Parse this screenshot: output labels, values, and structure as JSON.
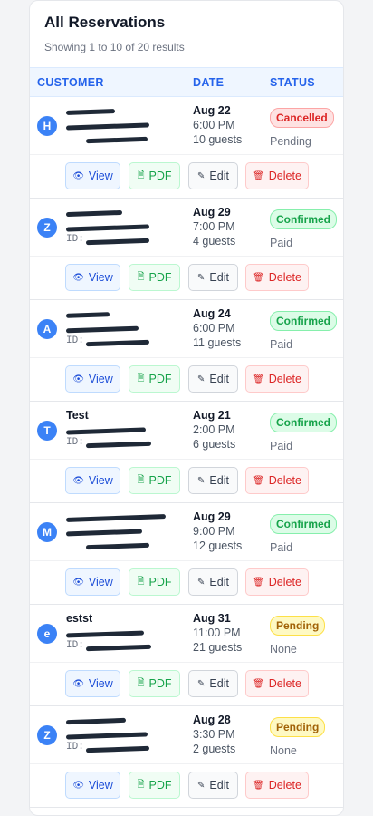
{
  "header": {
    "title": "All Reservations",
    "subtitle": "Showing 1 to 10 of 20 results"
  },
  "columns": {
    "customer": "CUSTOMER",
    "date": "DATE",
    "status": "STATUS"
  },
  "actions": {
    "view": "View",
    "pdf": "PDF",
    "edit": "Edit",
    "delete": "Delete"
  },
  "icons": {
    "view": "eye-icon",
    "pdf": "file-icon",
    "edit": "pencil-icon",
    "delete": "trash-icon"
  },
  "status_colors": {
    "Cancelled": "#dc2626",
    "Confirmed": "#16a34a",
    "Pending": "#a16207"
  },
  "rows": [
    {
      "initial": "H",
      "name": "",
      "phone": "",
      "id_prefix": "",
      "month_day": "Aug 22",
      "time": "6:00 PM",
      "guests": "10 guests",
      "status": "Cancelled",
      "payment": "Pending"
    },
    {
      "initial": "Z",
      "name": "",
      "phone": "",
      "id_prefix": "ID:",
      "month_day": "Aug 29",
      "time": "7:00 PM",
      "guests": "4 guests",
      "status": "Confirmed",
      "payment": "Paid"
    },
    {
      "initial": "A",
      "name": "",
      "phone": "",
      "id_prefix": "ID:",
      "month_day": "Aug 24",
      "time": "6:00 PM",
      "guests": "11 guests",
      "status": "Confirmed",
      "payment": "Paid"
    },
    {
      "initial": "T",
      "name": "Test",
      "phone": "",
      "id_prefix": "ID:",
      "month_day": "Aug 21",
      "time": "2:00 PM",
      "guests": "6 guests",
      "status": "Confirmed",
      "payment": "Paid"
    },
    {
      "initial": "M",
      "name": "",
      "phone": "",
      "id_prefix": "",
      "month_day": "Aug 29",
      "time": "9:00 PM",
      "guests": "12 guests",
      "status": "Confirmed",
      "payment": "Paid"
    },
    {
      "initial": "e",
      "name": "estst",
      "phone": "",
      "id_prefix": "ID:",
      "month_day": "Aug 31",
      "time": "11:00 PM",
      "guests": "21 guests",
      "status": "Pending",
      "payment": "None"
    },
    {
      "initial": "Z",
      "name": "",
      "phone": "",
      "id_prefix": "ID:",
      "month_day": "Aug 28",
      "time": "3:30 PM",
      "guests": "2 guests",
      "status": "Pending",
      "payment": "None"
    }
  ]
}
